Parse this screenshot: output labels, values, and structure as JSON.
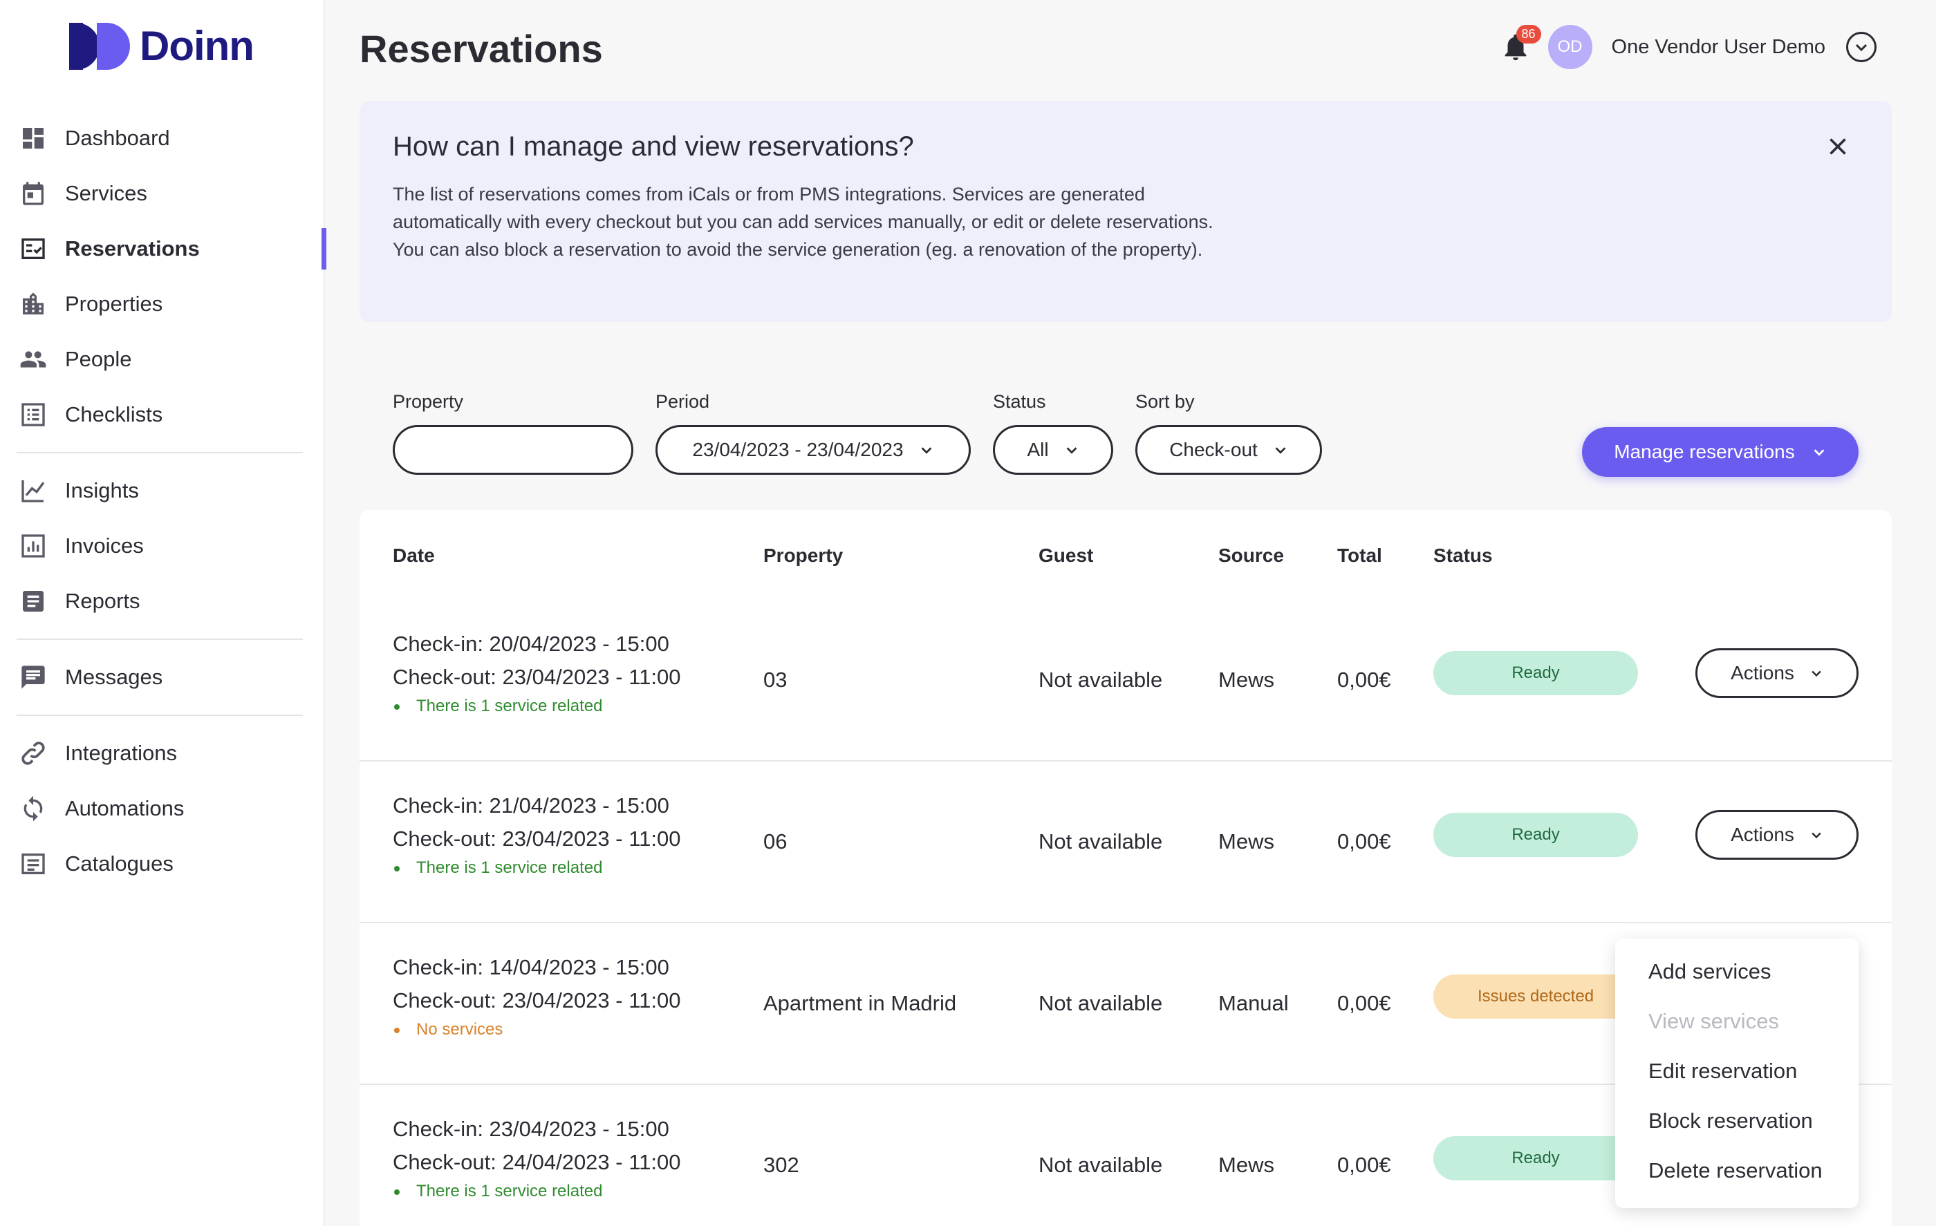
{
  "brand": {
    "name": "Doinn"
  },
  "sidebar": {
    "groups": [
      [
        {
          "label": "Dashboard",
          "icon": "dashboard-icon"
        },
        {
          "label": "Services",
          "icon": "calendar-icon"
        },
        {
          "label": "Reservations",
          "icon": "reservations-icon",
          "active": true
        },
        {
          "label": "Properties",
          "icon": "building-icon"
        },
        {
          "label": "People",
          "icon": "people-icon"
        },
        {
          "label": "Checklists",
          "icon": "checklist-icon"
        }
      ],
      [
        {
          "label": "Insights",
          "icon": "chart-line-icon"
        },
        {
          "label": "Invoices",
          "icon": "invoice-icon"
        },
        {
          "label": "Reports",
          "icon": "report-icon"
        }
      ],
      [
        {
          "label": "Messages",
          "icon": "message-icon"
        }
      ],
      [
        {
          "label": "Integrations",
          "icon": "link-icon"
        },
        {
          "label": "Automations",
          "icon": "sync-icon"
        },
        {
          "label": "Catalogues",
          "icon": "catalogue-icon"
        }
      ]
    ]
  },
  "header": {
    "title": "Reservations",
    "notifications_count": "86",
    "avatar_initials": "OD",
    "user_name": "One Vendor User Demo"
  },
  "banner": {
    "title": "How can I manage and view reservations?",
    "lines": [
      "The list of reservations comes from iCals or from PMS integrations. Services are generated",
      "automatically with every checkout but you can add services manually, or edit or delete reservations.",
      "You can also block a reservation to avoid the service generation (eg. a renovation of the property)."
    ]
  },
  "filters": {
    "property": {
      "label": "Property",
      "value": ""
    },
    "period": {
      "label": "Period",
      "value": "23/04/2023 - 23/04/2023"
    },
    "status": {
      "label": "Status",
      "value": "All"
    },
    "sort": {
      "label": "Sort by",
      "value": "Check-out"
    },
    "manage_button": "Manage reservations"
  },
  "table": {
    "columns": [
      "Date",
      "Property",
      "Guest",
      "Source",
      "Total",
      "Status"
    ],
    "actions_label": "Actions",
    "rows": [
      {
        "checkin": "Check-in: 20/04/2023 - 15:00",
        "checkout": "Check-out: 23/04/2023 - 11:00",
        "note": "There is 1 service related",
        "note_type": "green",
        "property": "03",
        "guest": "Not available",
        "source": "Mews",
        "total": "0,00€",
        "status": "Ready",
        "status_type": "ready",
        "show_actions": true
      },
      {
        "checkin": "Check-in: 21/04/2023 - 15:00",
        "checkout": "Check-out: 23/04/2023 - 11:00",
        "note": "There is 1 service related",
        "note_type": "green",
        "property": "06",
        "guest": "Not available",
        "source": "Mews",
        "total": "0,00€",
        "status": "Ready",
        "status_type": "ready",
        "show_actions": true
      },
      {
        "checkin": "Check-in: 14/04/2023 - 15:00",
        "checkout": "Check-out: 23/04/2023 - 11:00",
        "note": "No services",
        "note_type": "orange",
        "property": "Apartment in Madrid",
        "guest": "Not available",
        "source": "Manual",
        "total": "0,00€",
        "status": "Issues detected",
        "status_type": "issues",
        "show_actions": false
      },
      {
        "checkin": "Check-in: 23/04/2023 - 15:00",
        "checkout": "Check-out: 24/04/2023 - 11:00",
        "note": "There is 1 service related",
        "note_type": "green",
        "property": "302",
        "guest": "Not available",
        "source": "Mews",
        "total": "0,00€",
        "status": "Ready",
        "status_type": "ready",
        "show_actions": false
      }
    ]
  },
  "actions_menu": {
    "items": [
      {
        "label": "Add services",
        "disabled": false
      },
      {
        "label": "View services",
        "disabled": true
      },
      {
        "label": "Edit reservation",
        "disabled": false
      },
      {
        "label": "Block reservation",
        "disabled": false
      },
      {
        "label": "Delete reservation",
        "disabled": false
      }
    ]
  },
  "colors": {
    "accent": "#6b5cf0",
    "brand_dark": "#1f1a80",
    "ready_bg": "#c3eedb",
    "issues_bg": "#fbe0b4",
    "banner_bg": "#efeefb"
  }
}
